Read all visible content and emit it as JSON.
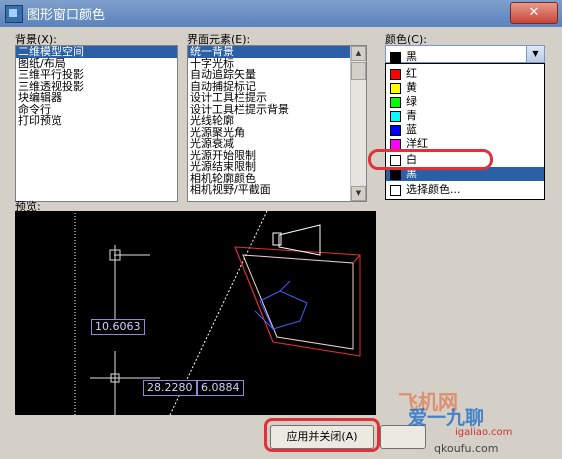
{
  "window": {
    "title": "图形窗口颜色",
    "close_glyph": "✕"
  },
  "background": {
    "label": "背景(X):",
    "items": [
      "二维模型空间",
      "图纸/布局",
      "三维平行投影",
      "三维透视投影",
      "块编辑器",
      "命令行",
      "打印预览"
    ],
    "selected_index": 0
  },
  "elements": {
    "label": "界面元素(E):",
    "items": [
      "统一背景",
      "十字光标",
      "自动追踪矢量",
      "自动捕捉标记",
      "设计工具栏提示",
      "设计工具栏提示背景",
      "光线轮廓",
      "光源聚光角",
      "光源衰减",
      "光源开始限制",
      "光源结束限制",
      "相机轮廓颜色",
      "相机视野/平截面"
    ],
    "selected_index": 0
  },
  "color": {
    "label": "颜色(C):",
    "selected": "黑",
    "selected_hex": "#000000",
    "options": [
      {
        "label": "红",
        "hex": "#ff0000"
      },
      {
        "label": "黄",
        "hex": "#ffff00"
      },
      {
        "label": "绿",
        "hex": "#00ff00"
      },
      {
        "label": "青",
        "hex": "#00ffff"
      },
      {
        "label": "蓝",
        "hex": "#0000ff"
      },
      {
        "label": "洋红",
        "hex": "#ff00ff"
      },
      {
        "label": "白",
        "hex": "#ffffff"
      },
      {
        "label": "黑",
        "hex": "#000000"
      },
      {
        "label": "选择颜色...",
        "hex": "#ffffff"
      }
    ],
    "highlighted_index": 7
  },
  "preview": {
    "label": "预览:",
    "dim1": "10.6063",
    "dim2": "28.2280",
    "dim3": "6.0884"
  },
  "buttons": {
    "apply_close": "应用并关闭(A)"
  },
  "watermark": {
    "line1": "飞机网",
    "line2": "爱一九聊",
    "line3": "igaliao.com",
    "line4": "qkoufu.com"
  }
}
